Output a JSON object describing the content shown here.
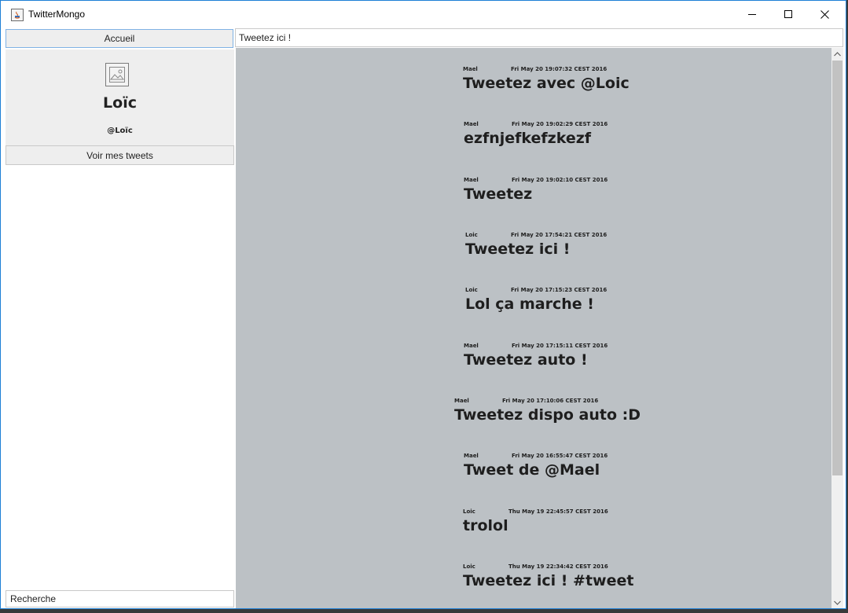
{
  "window": {
    "title": "TwitterMongo",
    "controls": {
      "minimize": "minimize-icon",
      "maximize": "maximize-icon",
      "close": "close-icon"
    }
  },
  "sidebar": {
    "home_label": "Accueil",
    "profile": {
      "name": "Loïc",
      "handle": "@Loïc",
      "avatar_icon": "image-placeholder-icon"
    },
    "my_tweets_label": "Voir mes tweets",
    "search_placeholder": "Recherche"
  },
  "composer": {
    "placeholder": "Tweetez ici !"
  },
  "feed": {
    "tweets": [
      {
        "author": "Mael",
        "date": "Fri May 20 19:07:32 CEST 2016",
        "text": "Tweetez avec @Loic"
      },
      {
        "author": "Mael",
        "date": "Fri May 20 19:02:29 CEST 2016",
        "text": "ezfnjefkefzkezf"
      },
      {
        "author": "Mael",
        "date": "Fri May 20 19:02:10 CEST 2016",
        "text": "Tweetez"
      },
      {
        "author": "Loic",
        "date": "Fri May 20 17:54:21 CEST 2016",
        "text": "Tweetez ici !"
      },
      {
        "author": "Loic",
        "date": "Fri May 20 17:15:23 CEST 2016",
        "text": "Lol ça marche !"
      },
      {
        "author": "Mael",
        "date": "Fri May 20 17:15:11 CEST 2016",
        "text": "Tweetez auto !"
      },
      {
        "author": "Mael",
        "date": "Fri May 20 17:10:06 CEST 2016",
        "text": "Tweetez dispo auto :D"
      },
      {
        "author": "Mael",
        "date": "Fri May 20 16:55:47 CEST 2016",
        "text": "Tweet de @Mael"
      },
      {
        "author": "Loic",
        "date": "Thu May 19 22:45:57 CEST 2016",
        "text": "trolol"
      },
      {
        "author": "Loic",
        "date": "Thu May 19 22:34:42 CEST 2016",
        "text": "Tweetez ici ! #tweet"
      }
    ]
  },
  "colors": {
    "feed_background": "#bcc1c5",
    "panel_background": "#eeeeee",
    "focus_border": "#7fb2e5",
    "window_border": "#1d7fd6"
  }
}
